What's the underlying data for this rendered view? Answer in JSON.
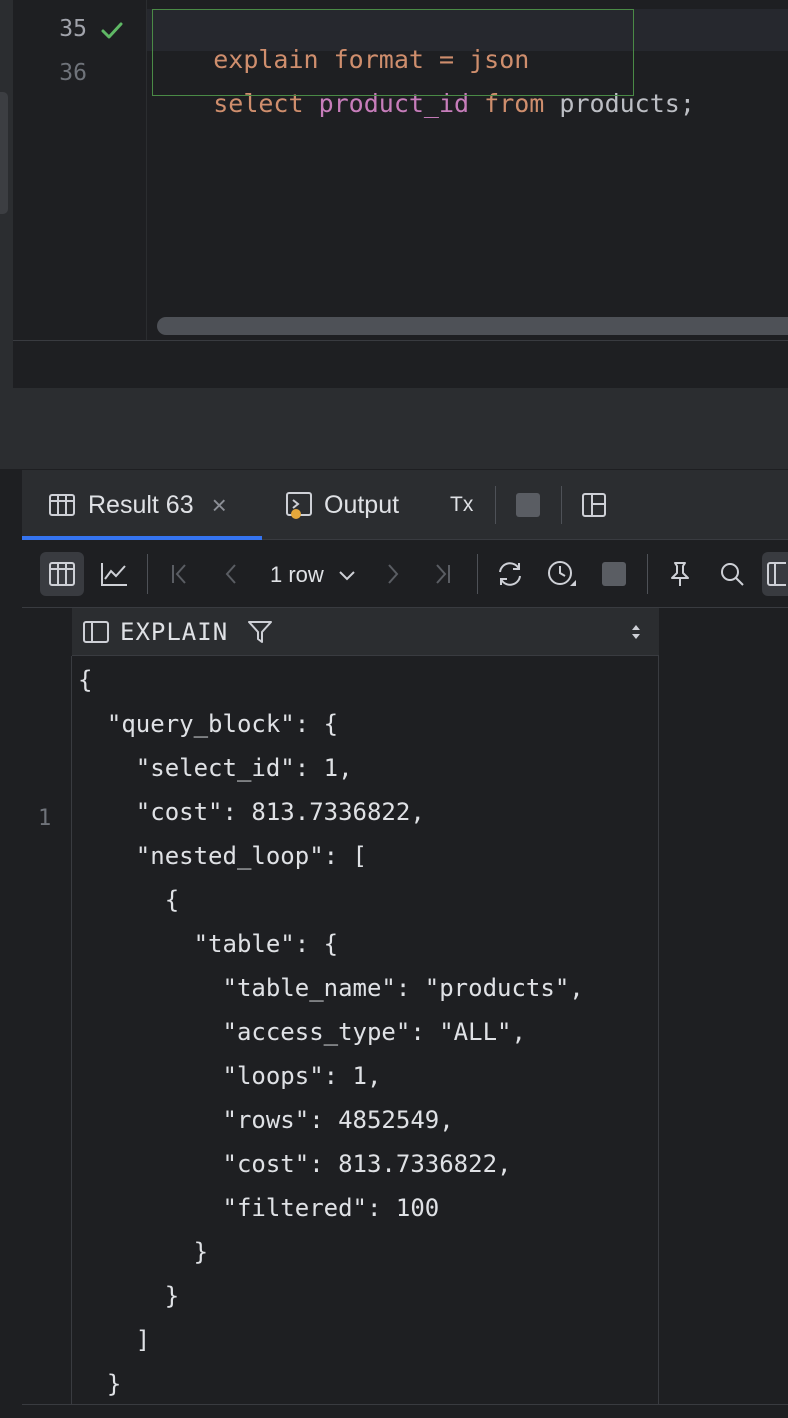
{
  "editor": {
    "lines": [
      {
        "number": "35",
        "status": "check-icon",
        "tokens": [
          {
            "text": "explain format = json",
            "kind": "keyword"
          }
        ]
      },
      {
        "number": "36",
        "tokens": [
          {
            "text": "select ",
            "kind": "keyword"
          },
          {
            "text": "product_id ",
            "kind": "column"
          },
          {
            "text": "from ",
            "kind": "keyword"
          },
          {
            "text": "products",
            "kind": "plain"
          },
          {
            "text": ";",
            "kind": "plain"
          }
        ]
      }
    ]
  },
  "results": {
    "tabs": [
      {
        "label": "Result 63",
        "active": true,
        "closable": true,
        "icon": "table-icon"
      },
      {
        "label": "Output",
        "icon": "console-icon"
      },
      {
        "label": "Tx",
        "icon": "transaction-icon"
      }
    ],
    "toolbar": {
      "rows_label": "1 row"
    },
    "column": {
      "label": "EXPLAIN"
    },
    "row_number": "1",
    "json_lines": [
      "{",
      "  \"query_block\": {",
      "    \"select_id\": 1,",
      "    \"cost\": 813.7336822,",
      "    \"nested_loop\": [",
      "      {",
      "        \"table\": {",
      "          \"table_name\": \"products\",",
      "          \"access_type\": \"ALL\",",
      "          \"loops\": 1,",
      "          \"rows\": 4852549,",
      "          \"cost\": 813.7336822,",
      "          \"filtered\": 100",
      "        }",
      "      }",
      "    ]",
      "  }"
    ]
  },
  "colors": {
    "keyword": "#cf8e6d",
    "column": "#c77dbb",
    "plain": "#bcbec4",
    "accent": "#3574f0",
    "check": "#5fb865"
  }
}
